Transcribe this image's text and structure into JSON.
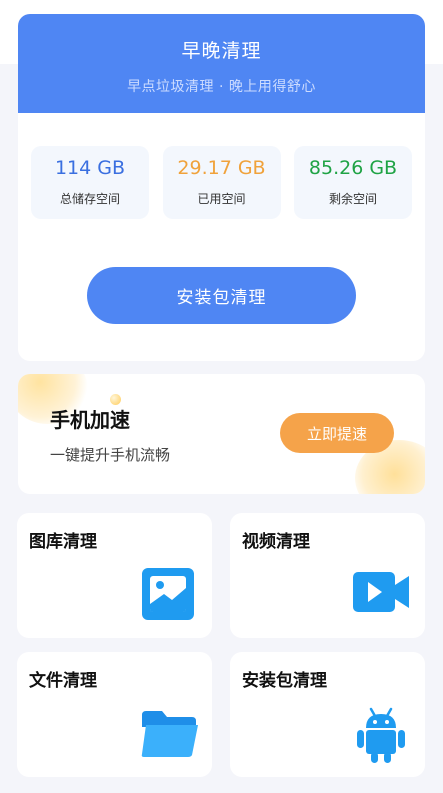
{
  "header": {
    "title": "早晚清理",
    "subtitle": "早点垃圾清理 · 晚上用得舒心"
  },
  "storage": {
    "stats": [
      {
        "value": "114 GB",
        "label": "总储存空间",
        "color": "#3a6fe0"
      },
      {
        "value": "29.17 GB",
        "label": "已用空间",
        "color": "#f0a23b"
      },
      {
        "value": "85.26 GB",
        "label": "剩余空间",
        "color": "#1fa345"
      }
    ],
    "button_label": "安装包清理"
  },
  "speed": {
    "title": "手机加速",
    "subtitle": "一键提升手机流畅",
    "button_label": "立即提速"
  },
  "tiles": [
    {
      "label": "图库清理",
      "icon": "gallery-icon"
    },
    {
      "label": "视频清理",
      "icon": "video-icon"
    },
    {
      "label": "文件清理",
      "icon": "folder-icon"
    },
    {
      "label": "安装包清理",
      "icon": "android-icon"
    }
  ],
  "colors": {
    "accent": "#4f86f3",
    "speed_button": "#f5a34a",
    "icon_blue": "#1f9bf0"
  }
}
